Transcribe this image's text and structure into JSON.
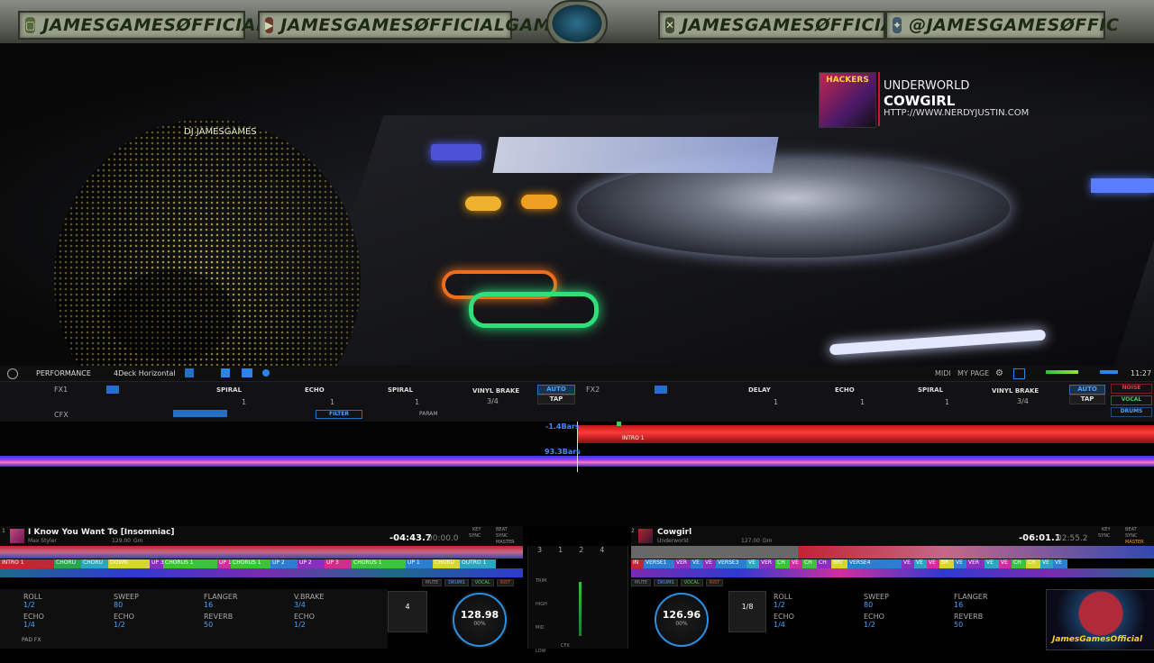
{
  "banner": {
    "items": [
      {
        "icon": "twitch-icon",
        "glyph": "▢",
        "label": "JAMESGAMESØFFICIAL"
      },
      {
        "icon": "youtube-icon",
        "glyph": "▶",
        "label": "JAMESGAMESØFFICIALGAME"
      },
      {
        "icon": "x-icon",
        "glyph": "✕",
        "label": "JAMESGAMESØFFICIAL"
      },
      {
        "icon": "twitter-icon",
        "glyph": "✦",
        "label": "@JAMESGAMESØFFIC"
      }
    ]
  },
  "now_playing": {
    "artist": "UNDERWORLD",
    "title": "COWGIRL",
    "url": "HTTP://WWW.NERDYJUSTIN.COM",
    "cover_text": "HACKERS"
  },
  "overlay": {
    "holo_label": "DJ JAMESGAMES",
    "watermark": "JamesGamesOfficial"
  },
  "toolbar": {
    "mode": "PERFORMANCE",
    "layout": "4Deck Horizontal",
    "midi": "MIDI",
    "mypage": "MY PAGE",
    "clock": "11:27"
  },
  "fx": {
    "fx1_label": "FX1",
    "fx2_label": "FX2",
    "cfx_label": "CFX",
    "fx1_slots": [
      "SPIRAL",
      "ECHO",
      "SPIRAL",
      "VINYL BRAKE"
    ],
    "fx2_slots": [
      "DELAY",
      "ECHO",
      "SPIRAL",
      "VINYL BRAKE"
    ],
    "beat_vals": [
      "1",
      "1",
      "1",
      "3/4"
    ],
    "auto": "AUTO",
    "tap": "TAP",
    "cfx_filter": "FILTER",
    "cfx_param": "PARAM",
    "right_btns": [
      "NOISE",
      "VOCAL",
      "DRUMS"
    ]
  },
  "overview": {
    "left_bars": "-1.4Bars",
    "right_bars": "93.3Bars",
    "intro": "INTRO 1"
  },
  "decks": {
    "left": {
      "num": "1",
      "title": "I Know You Want To [Insomniac]",
      "artist": "Max Styler",
      "bpm_small": "129.00",
      "key_small": "Gm",
      "time_remain": "-04:43.7",
      "time_elapsed": "00:00.0",
      "key_lbl": "KEY",
      "sync_lbl": "SYNC",
      "beat_lbl": "BEAT",
      "master_lbl": "MASTER",
      "cues": [
        {
          "l": "INTRO 1",
          "c": "#c3262e",
          "w": 60
        },
        {
          "l": "CHORU",
          "c": "#29a64a",
          "w": 30
        },
        {
          "l": "CHORU",
          "c": "#2aa6c0",
          "w": 30
        },
        {
          "l": "DOWN",
          "c": "#d6d630",
          "w": 46
        },
        {
          "l": "UP 3",
          "c": "#8a2ec0",
          "w": 15
        },
        {
          "l": "CHORUS 1",
          "c": "#3ac43a",
          "w": 60
        },
        {
          "l": "UP 1",
          "c": "#d02ea0",
          "w": 15
        },
        {
          "l": "CHORUS 1",
          "c": "#3ac43a",
          "w": 44
        },
        {
          "l": "UP 2",
          "c": "#2c7ed0",
          "w": 30
        },
        {
          "l": "UP 2",
          "c": "#8a2ec0",
          "w": 30
        },
        {
          "l": "UP 3",
          "c": "#d02e8a",
          "w": 30
        },
        {
          "l": "CHORUS 1",
          "c": "#3ac43a",
          "w": 60
        },
        {
          "l": "UP 1",
          "c": "#2c7ed0",
          "w": 30
        },
        {
          "l": "CHORU",
          "c": "#d6d630",
          "w": 30
        },
        {
          "l": "OUTRO 1",
          "c": "#2aa6c0",
          "w": 40
        }
      ],
      "pads": [
        {
          "name": "ROLL",
          "val": "1/2"
        },
        {
          "name": "SWEEP",
          "val": "80"
        },
        {
          "name": "FLANGER",
          "val": "16"
        },
        {
          "name": "V.BRAKE",
          "val": "3/4"
        },
        {
          "name": "ECHO",
          "val": "1/4"
        },
        {
          "name": "ECHO",
          "val": "1/2"
        },
        {
          "name": "REVERB",
          "val": "50"
        },
        {
          "name": "ECHO",
          "val": "1/2"
        }
      ],
      "beatjump": "4",
      "bpm": "128.98",
      "pitch": "00%",
      "padfx": "PAD FX",
      "toggles": [
        "MUTE",
        "DRUMS",
        "VOCAL",
        "INST"
      ]
    },
    "right": {
      "num": "2",
      "title": "Cowgirl",
      "artist": "Underworld",
      "bpm_small": "127.00",
      "key_small": "Dm",
      "time_remain": "-06:01.1",
      "time_elapsed": "02:55.2",
      "cues": [
        {
          "l": "IN",
          "c": "#c3262e",
          "w": 14
        },
        {
          "l": "VERSE1",
          "c": "#2c7ed0",
          "w": 34
        },
        {
          "l": "VER",
          "c": "#8a2ec0",
          "w": 18
        },
        {
          "l": "VE",
          "c": "#2c7ed0",
          "w": 14
        },
        {
          "l": "VE",
          "c": "#8a2ec0",
          "w": 14
        },
        {
          "l": "VERSE3",
          "c": "#2c7ed0",
          "w": 34
        },
        {
          "l": "VE",
          "c": "#2aa6c0",
          "w": 14
        },
        {
          "l": "VER",
          "c": "#8a2ec0",
          "w": 18
        },
        {
          "l": "CH",
          "c": "#3ac43a",
          "w": 16
        },
        {
          "l": "VE",
          "c": "#d02ea0",
          "w": 14
        },
        {
          "l": "CH",
          "c": "#3ac43a",
          "w": 16
        },
        {
          "l": "CH",
          "c": "#8a2ec0",
          "w": 16
        },
        {
          "l": "BRI",
          "c": "#d6d630",
          "w": 18
        },
        {
          "l": "VERSE4",
          "c": "#2c7ed0",
          "w": 60
        },
        {
          "l": "VE",
          "c": "#8a2ec0",
          "w": 14
        },
        {
          "l": "VE",
          "c": "#2aa6c0",
          "w": 14
        },
        {
          "l": "VE",
          "c": "#d02ea0",
          "w": 14
        },
        {
          "l": "BR",
          "c": "#d6d630",
          "w": 16
        },
        {
          "l": "VE",
          "c": "#2c7ed0",
          "w": 14
        },
        {
          "l": "VER",
          "c": "#8a2ec0",
          "w": 20
        },
        {
          "l": "VE",
          "c": "#2aa6c0",
          "w": 16
        },
        {
          "l": "VE",
          "c": "#d02ea0",
          "w": 14
        },
        {
          "l": "CH",
          "c": "#3ac43a",
          "w": 16
        },
        {
          "l": "CH",
          "c": "#d6d630",
          "w": 16
        },
        {
          "l": "VE",
          "c": "#2aa6c0",
          "w": 14
        },
        {
          "l": "VE",
          "c": "#2c7ed0",
          "w": 16
        }
      ],
      "pads": [
        {
          "name": "ROLL",
          "val": "1/2"
        },
        {
          "name": "SWEEP",
          "val": "80"
        },
        {
          "name": "FLANGER",
          "val": "16"
        },
        {
          "name": "ECHO",
          "val": "1/4"
        },
        {
          "name": "ECHO",
          "val": "1/2"
        },
        {
          "name": "REVERB",
          "val": "50"
        }
      ],
      "beatjump": "1/8",
      "bpm": "126.96",
      "pitch": "00%",
      "toggles": [
        "MUTE",
        "DRUMS",
        "VOCAL",
        "INST"
      ]
    },
    "mixer": {
      "channels": [
        "3",
        "1",
        "2",
        "4"
      ],
      "rows": [
        "TRIM",
        "HIGH",
        "MID",
        "LOW"
      ],
      "cfx": "CFX"
    }
  }
}
